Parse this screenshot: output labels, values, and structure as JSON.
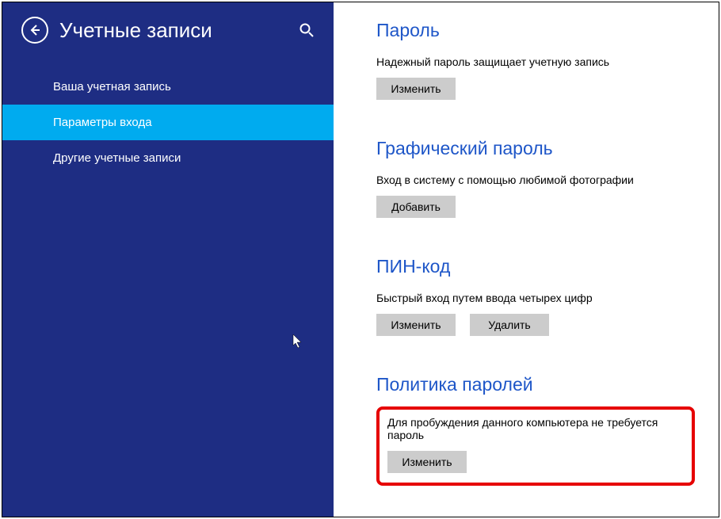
{
  "header": {
    "title": "Учетные записи"
  },
  "nav": {
    "items": [
      {
        "label": "Ваша учетная запись",
        "active": false
      },
      {
        "label": "Параметры входа",
        "active": true
      },
      {
        "label": "Другие учетные записи",
        "active": false
      }
    ]
  },
  "sections": {
    "password": {
      "title": "Пароль",
      "desc": "Надежный пароль защищает учетную запись",
      "change": "Изменить"
    },
    "picture": {
      "title": "Графический пароль",
      "desc": "Вход в систему с помощью любимой фотографии",
      "add": "Добавить"
    },
    "pin": {
      "title": "ПИН-код",
      "desc": "Быстрый вход путем ввода четырех цифр",
      "change": "Изменить",
      "delete": "Удалить"
    },
    "policy": {
      "title": "Политика паролей",
      "desc": "Для пробуждения данного компьютера не требуется пароль",
      "change": "Изменить"
    }
  }
}
